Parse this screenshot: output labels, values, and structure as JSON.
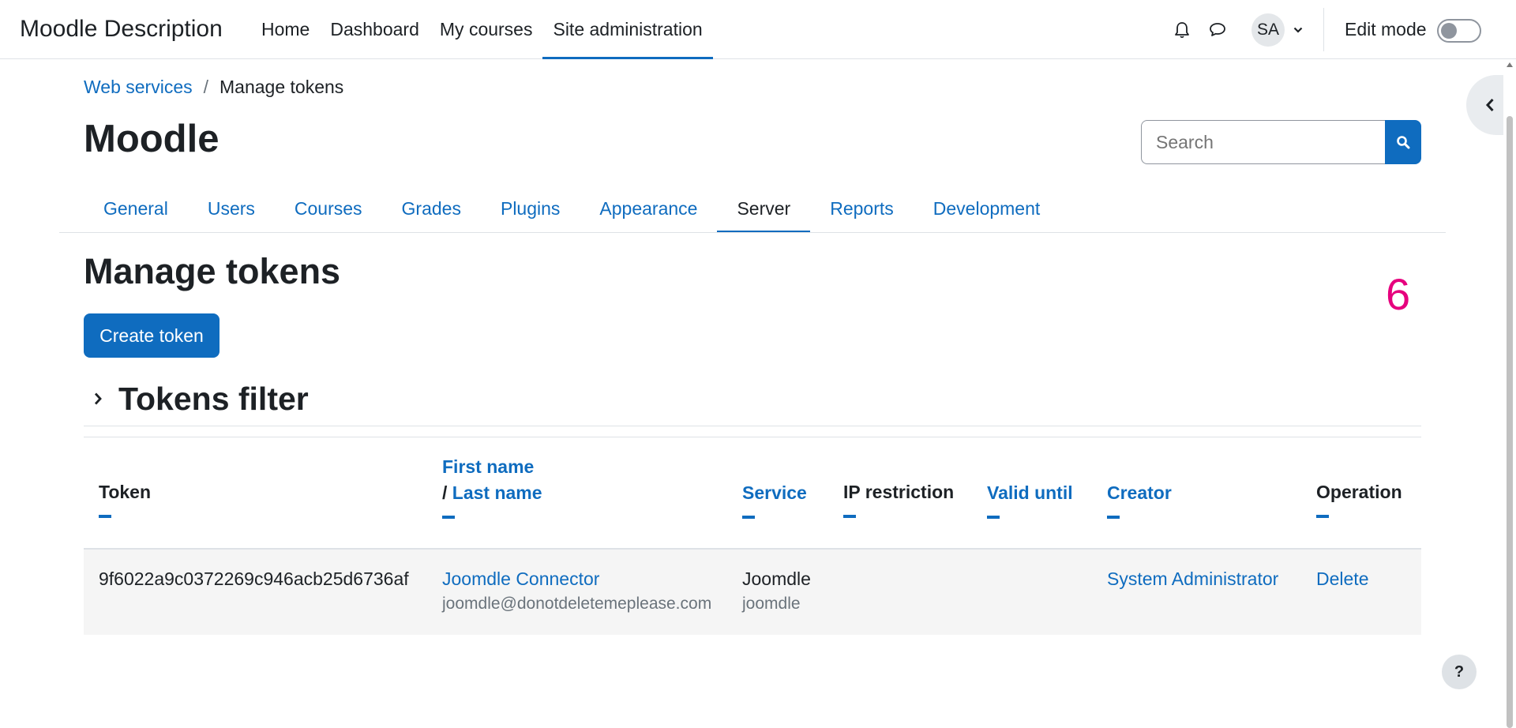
{
  "navbar": {
    "brand": "Moodle Description",
    "items": [
      {
        "label": "Home",
        "active": false
      },
      {
        "label": "Dashboard",
        "active": false
      },
      {
        "label": "My courses",
        "active": false
      },
      {
        "label": "Site administration",
        "active": true
      }
    ],
    "notification_icon": "bell-icon",
    "messages_icon": "chat-icon",
    "avatar_initials": "SA",
    "edit_mode_label": "Edit mode",
    "edit_mode_on": false
  },
  "breadcrumb": {
    "parent": "Web services",
    "separator": "/",
    "current": "Manage tokens"
  },
  "header": {
    "title": "Moodle"
  },
  "search": {
    "placeholder": "Search"
  },
  "secondary_nav": [
    {
      "label": "General",
      "active": false
    },
    {
      "label": "Users",
      "active": false
    },
    {
      "label": "Courses",
      "active": false
    },
    {
      "label": "Grades",
      "active": false
    },
    {
      "label": "Plugins",
      "active": false
    },
    {
      "label": "Appearance",
      "active": false
    },
    {
      "label": "Server",
      "active": true
    },
    {
      "label": "Reports",
      "active": false
    },
    {
      "label": "Development",
      "active": false
    }
  ],
  "page": {
    "title": "Manage tokens",
    "annotation_number": "6",
    "create_button": "Create token",
    "filter_title": "Tokens filter"
  },
  "table": {
    "headers": {
      "token": "Token",
      "first_name": "First name",
      "name_sep": "/",
      "last_name": "Last name",
      "service": "Service",
      "ip_restriction": "IP restriction",
      "valid_until": "Valid until",
      "creator": "Creator",
      "operation": "Operation"
    },
    "rows": [
      {
        "token": "9f6022a9c0372269c946acb25d6736af",
        "user_name": "Joomdle Connector",
        "user_email": "joomdle@donotdeletemeplease.com",
        "service_name": "Joomdle",
        "service_shortname": "joomdle",
        "ip_restriction": "",
        "valid_until": "",
        "creator": "System Administrator",
        "operation": "Delete"
      }
    ]
  },
  "help_button": "?",
  "colors": {
    "primary": "#0f6cbf",
    "text": "#1d2125",
    "muted": "#6a737b",
    "annotation": "#e6007e"
  }
}
